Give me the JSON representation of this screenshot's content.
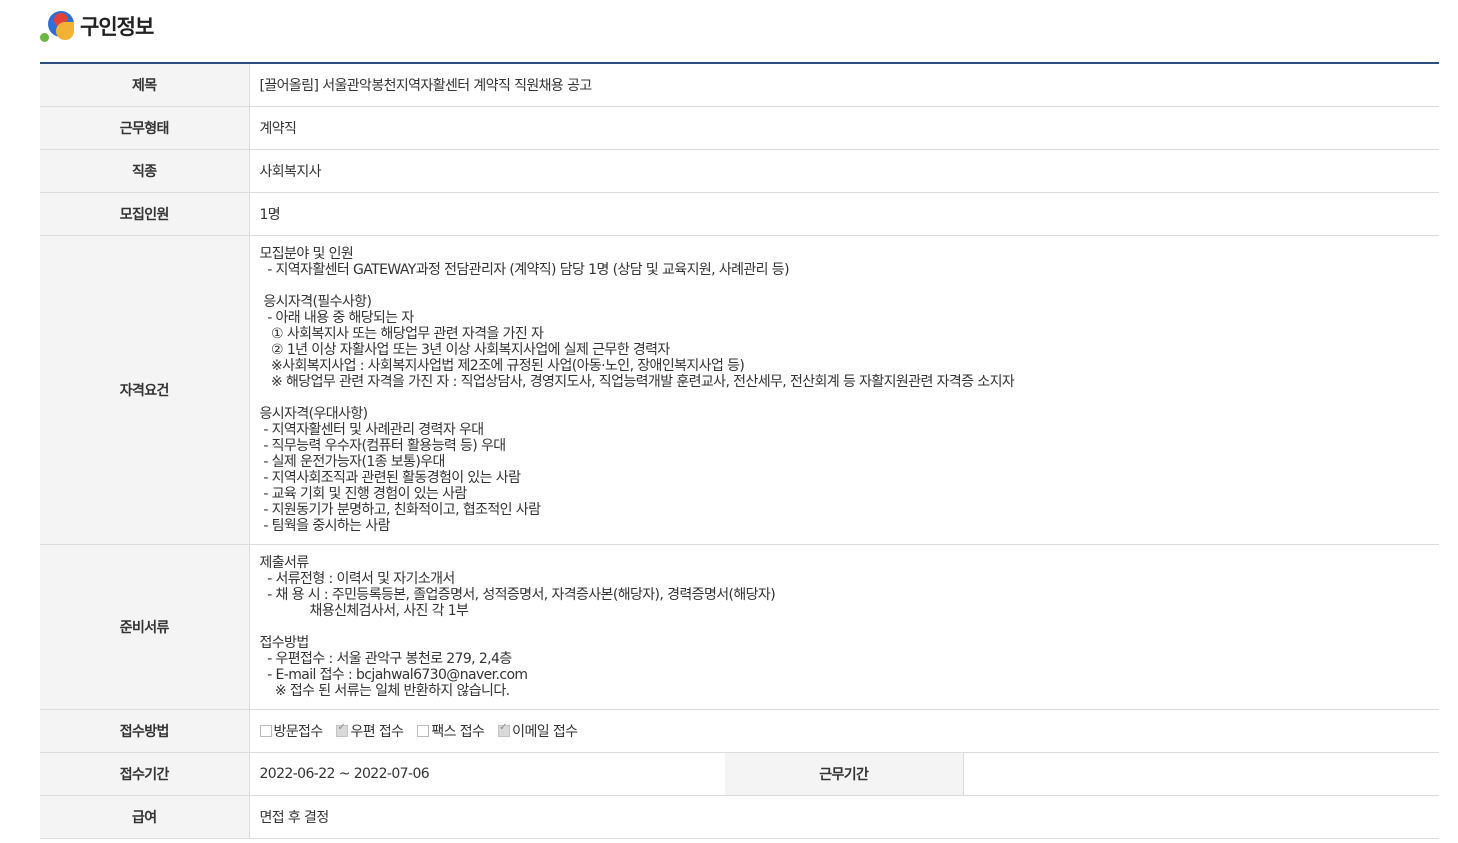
{
  "header": {
    "title": "구인정보"
  },
  "rows": {
    "title": {
      "label": "제목",
      "value": "[끌어올림] 서울관악봉천지역자활센터 계약직 직원채용 공고"
    },
    "work_type": {
      "label": "근무형태",
      "value": "계약직"
    },
    "job": {
      "label": "직종",
      "value": "사회복지사"
    },
    "headcount": {
      "label": "모집인원",
      "value": "1명"
    },
    "qualifications": {
      "label": "자격요건",
      "lines": [
        "모집분야 및 인원",
        "  - 지역자활센터 GATEWAY과정 전담관리자 (계약직) 담당 1명 (상담 및 교육지원, 사례관리 등)",
        "",
        " 응시자격(필수사항)",
        "  - 아래 내용 중 해당되는 자",
        "   ① 사회복지사 또는 해당업무 관련 자격을 가진 자",
        "   ② 1년 이상 자활사업 또는 3년 이상 사회복지사업에 실제 근무한 경력자",
        "   ※사회복지사업 : 사회복지사업법 제2조에 규정된 사업(아동·노인, 장애인복지사업 등)",
        "   ※ 해당업무 관련 자격을 가진 자 : 직업상담사, 경영지도사, 직업능력개발 훈련교사, 전산세무, 전산회계 등 자활지원관련 자격증 소지자",
        "",
        "응시자격(우대사항)",
        " - 지역자활센터 및 사례관리 경력자 우대",
        " - 직무능력 우수자(컴퓨터 활용능력 등) 우대",
        " - 실제 운전가능자(1종 보통)우대",
        " - 지역사회조직과 관련된 활동경험이 있는 사람",
        " - 교육 기회 및 진행 경험이 있는 사람",
        " - 지원동기가 분명하고, 친화적이고, 협조적인 사람",
        " - 팀웍을 중시하는 사람"
      ]
    },
    "documents": {
      "label": "준비서류",
      "lines": [
        "제출서류",
        "  - 서류전형 : 이력서 및 자기소개서",
        "  - 채 용 시 : 주민등록등본, 졸업증명서, 성적증명서, 자격증사본(해당자), 경력증명서(해당자)",
        "             채용신체검사서, 사진 각 1부",
        "",
        "접수방법",
        "  - 우편접수 : 서울 관악구 봉천로 279, 2,4층",
        "  - E-mail 접수 : bcjahwal6730@naver.com",
        "    ※ 접수 된 서류는 일체 반환하지 않습니다."
      ]
    },
    "methods": {
      "label": "접수방법",
      "options": [
        {
          "label": "방문접수",
          "checked": false
        },
        {
          "label": "우편 접수",
          "checked": true
        },
        {
          "label": "팩스 접수",
          "checked": false
        },
        {
          "label": "이메일 접수",
          "checked": true
        }
      ]
    },
    "period": {
      "label": "접수기간",
      "value": "2022-06-22 ~ 2022-07-06",
      "work_period_label": "근무기간",
      "work_period_value": ""
    },
    "salary": {
      "label": "급여",
      "value": "면접 후 결정"
    }
  }
}
